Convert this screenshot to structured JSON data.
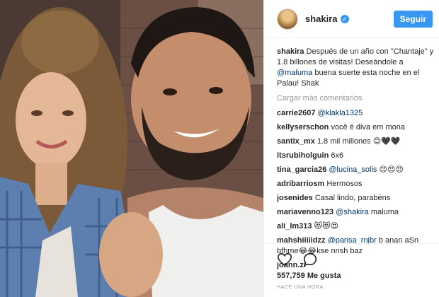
{
  "header": {
    "username": "shakira",
    "follow_label": "Seguir"
  },
  "caption": {
    "user": "shakira",
    "text_1": "Después de un año con \"Chantaje\" y 1.8 billones de visitas! Deseándole a",
    "mention": "@maluma",
    "text_2": "buena suerte esta noche en el Palau! Shak"
  },
  "load_more_label": "Cargar más comentarios",
  "comments": [
    {
      "user": "carrie2607",
      "mention": "@klakla1325",
      "text": ""
    },
    {
      "user": "kellyserschon",
      "mention": "",
      "text": "você é diva em mona"
    },
    {
      "user": "santix_mx",
      "mention": "",
      "text": "1.8 mil millones 😊🖤🖤"
    },
    {
      "user": "itsrubiholguin",
      "mention": "",
      "text": "6x6"
    },
    {
      "user": "tina_garcia26",
      "mention": "@lucina_solis",
      "text": "😍😍😍"
    },
    {
      "user": "adribarriosm",
      "mention": "",
      "text": "Hermosos"
    },
    {
      "user": "josenides",
      "mention": "",
      "text": "Casal lindo, parabéns"
    },
    {
      "user": "mariavenno123",
      "mention": "@shakira",
      "text": "maluma"
    },
    {
      "user": "ali_lm313",
      "mention": "",
      "text": "😻😻😍"
    },
    {
      "user": "mahshiiiiidzz",
      "mention": "@parisa_rnjbr",
      "text": "b anan aSn bfhme😂😂kse nnsh baz"
    },
    {
      "user": "joann.zi",
      "mention": "",
      "text": ""
    }
  ],
  "likes_text": "557,759 Me gusta",
  "time_text": "HACE UNA HORA",
  "colors": {
    "accent": "#3897f0",
    "mention": "#003569",
    "muted": "#999999"
  },
  "icons": [
    "heart-icon",
    "comment-icon",
    "verified-icon"
  ]
}
